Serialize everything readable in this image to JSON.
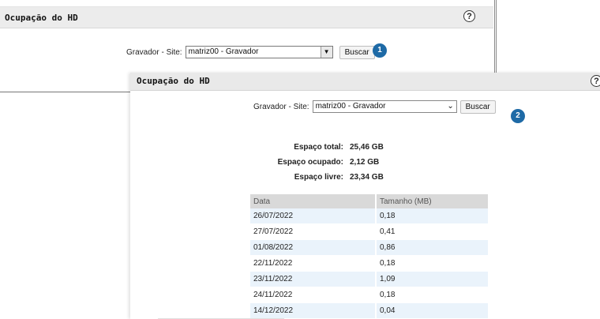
{
  "back_panel": {
    "title": "Ocupação do HD",
    "help": "?",
    "filter_label": "Gravador - Site:",
    "select_value": "matriz00 - Gravador",
    "button_label": "Buscar",
    "badge": "1"
  },
  "front_panel": {
    "title": "Ocupação do HD",
    "help": "?",
    "filter_label": "Gravador - Site:",
    "select_value": "matriz00 - Gravador",
    "button_label": "Buscar",
    "badge": "2",
    "stats": {
      "total_label": "Espaço total:",
      "total_value": "25,46 GB",
      "used_label": "Espaço ocupado:",
      "used_value": "2,12 GB",
      "free_label": "Espaço livre:",
      "free_value": "23,34 GB"
    },
    "table": {
      "headers": [
        "Data",
        "Tamanho (MB)"
      ],
      "rows": [
        [
          "26/07/2022",
          "0,18"
        ],
        [
          "27/07/2022",
          "0,41"
        ],
        [
          "01/08/2022",
          "0,86"
        ],
        [
          "22/11/2022",
          "0,18"
        ],
        [
          "23/11/2022",
          "1,09"
        ],
        [
          "24/11/2022",
          "0,18"
        ],
        [
          "14/12/2022",
          "0,04"
        ]
      ]
    }
  },
  "colors": {
    "badge": "#1e6aa6",
    "header_bg": "#e9e9e9",
    "table_header_bg": "#d9d9d9",
    "row_alt_bg": "#eaf3fb"
  }
}
